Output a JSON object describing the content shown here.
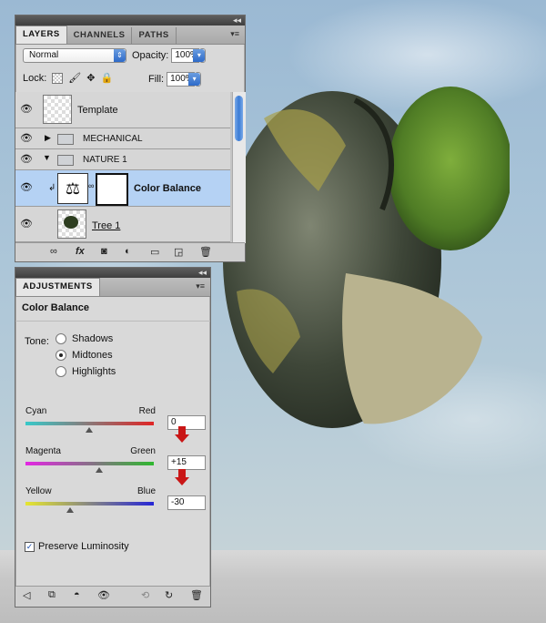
{
  "layers_panel": {
    "tabs": [
      "LAYERS",
      "CHANNELS",
      "PATHS"
    ],
    "blend_mode": "Normal",
    "opacity_label": "Opacity:",
    "opacity_value": "100%",
    "lock_label": "Lock:",
    "fill_label": "Fill:",
    "fill_value": "100%",
    "layers": [
      {
        "name": "Template"
      },
      {
        "name": "MECHANICAL"
      },
      {
        "name": "NATURE 1"
      },
      {
        "name": "Color Balance"
      },
      {
        "name": "Tree 1"
      }
    ]
  },
  "adjustments_panel": {
    "tab": "ADJUSTMENTS",
    "title": "Color Balance",
    "tone_label": "Tone:",
    "tones": [
      "Shadows",
      "Midtones",
      "Highlights"
    ],
    "selected_tone": "Midtones",
    "sliders": [
      {
        "left": "Cyan",
        "right": "Red",
        "value": "0",
        "level": 0,
        "gradient": [
          "#37c9c9",
          "#e02525"
        ]
      },
      {
        "left": "Magenta",
        "right": "Green",
        "value": "+15",
        "level": 15,
        "gradient": [
          "#e326e3",
          "#2fb82f"
        ]
      },
      {
        "left": "Yellow",
        "right": "Blue",
        "value": "-30",
        "level": -30,
        "gradient": [
          "#e6e630",
          "#2626d6"
        ]
      }
    ],
    "preserve_label": "Preserve Luminosity",
    "preserve_checked": true
  },
  "colors": {
    "accent": "#3a7bd5",
    "arrow": "#c91616",
    "selected_row": "#b5d2f4"
  }
}
